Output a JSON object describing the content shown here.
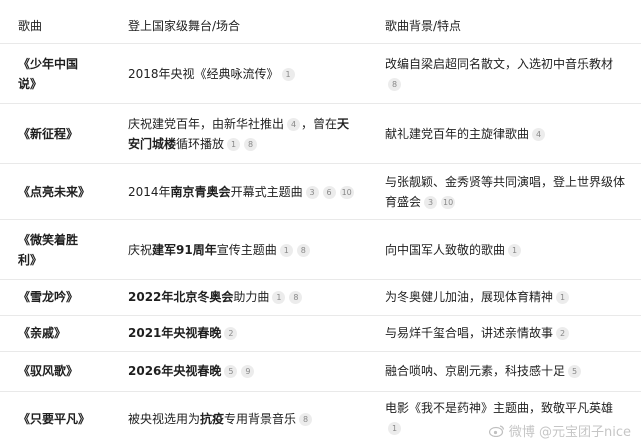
{
  "header": {
    "song": "歌曲",
    "stage": "登上国家级舞台/场合",
    "background": "歌曲背景/特点"
  },
  "rows": [
    {
      "song": "《少年中国说》",
      "stage": [
        {
          "t": "2018年央视《经典咏流传》"
        }
      ],
      "stage_cites": [
        "1"
      ],
      "bg": [
        {
          "t": "改编自梁启超同名散文，入选初中音乐教材"
        }
      ],
      "bg_cites": [
        "8"
      ]
    },
    {
      "song": "《新征程》",
      "stage": [
        {
          "t": "庆祝建党百年，由新华社推出"
        }
      ],
      "stage_cites": [
        "4"
      ],
      "stage2": [
        {
          "t": "，曾在"
        },
        {
          "t": "天安门城楼",
          "b": true
        },
        {
          "t": "循环播放"
        }
      ],
      "stage2_cites": [
        "1",
        "8"
      ],
      "bg": [
        {
          "t": "献礼建党百年的主旋律歌曲"
        }
      ],
      "bg_cites": [
        "4"
      ]
    },
    {
      "song": "《点亮未来》",
      "stage": [
        {
          "t": "2014年"
        },
        {
          "t": "南京青奥会",
          "b": true
        },
        {
          "t": "开幕式主题曲"
        }
      ],
      "stage_cites": [
        "3",
        "6",
        "10"
      ],
      "bg": [
        {
          "t": "与张靓颖、金秀贤等共同演唱，登上世界级体育盛会"
        }
      ],
      "bg_cites": [
        "3",
        "10"
      ]
    },
    {
      "song": "《微笑着胜利》",
      "stage": [
        {
          "t": "庆祝"
        },
        {
          "t": "建军91周年",
          "b": true
        },
        {
          "t": "宣传主题曲"
        }
      ],
      "stage_cites": [
        "1",
        "8"
      ],
      "bg": [
        {
          "t": "向中国军人致敬的歌曲"
        }
      ],
      "bg_cites": [
        "1"
      ]
    },
    {
      "song": "《雪龙吟》",
      "stage": [
        {
          "t": "2022年北京冬奥会",
          "b": true
        },
        {
          "t": "助力曲"
        }
      ],
      "stage_cites": [
        "1",
        "8"
      ],
      "bg": [
        {
          "t": "为冬奥健儿加油，展现体育精神"
        }
      ],
      "bg_cites": [
        "1"
      ]
    },
    {
      "song": "《亲戚》",
      "stage": [
        {
          "t": "2021年央视春晚",
          "b": true
        }
      ],
      "stage_cites": [
        "2"
      ],
      "bg": [
        {
          "t": "与易烊千玺合唱，讲述亲情故事"
        }
      ],
      "bg_cites": [
        "2"
      ]
    },
    {
      "song": "《驭风歌》",
      "stage": [
        {
          "t": "2026年央视春晚",
          "b": true
        }
      ],
      "stage_cites": [
        "5",
        "9"
      ],
      "bg": [
        {
          "t": "融合唢呐、京剧元素，科技感十足"
        }
      ],
      "bg_cites": [
        "5"
      ]
    },
    {
      "song": "《只要平凡》",
      "stage": [
        {
          "t": "被央视选用为"
        },
        {
          "t": "抗疫",
          "b": true
        },
        {
          "t": "专用背景音乐"
        }
      ],
      "stage_cites": [
        "8"
      ],
      "bg": [
        {
          "t": "电影《我不是药神》主题曲，致敬平凡英雄"
        }
      ],
      "bg_cites": [
        "1"
      ]
    }
  ],
  "watermark": "微博 @元宝团子nice",
  "colors": {
    "divider": "#e9e9e9",
    "cite_bg": "#ececec",
    "cite_text": "#888888",
    "text": "#1f1f1f"
  }
}
